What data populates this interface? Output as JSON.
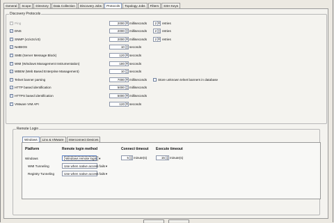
{
  "tabs": [
    {
      "label": "General",
      "active": false
    },
    {
      "label": "Scope",
      "active": false
    },
    {
      "label": "Directory",
      "active": false
    },
    {
      "label": "Data Collection",
      "active": false
    },
    {
      "label": "Discovery Jobs",
      "active": false
    },
    {
      "label": "Protocols",
      "active": true
    },
    {
      "label": "Topology Jobs",
      "active": false
    },
    {
      "label": "Filters",
      "active": false
    },
    {
      "label": "SSH Keys",
      "active": false
    }
  ],
  "discovery": {
    "title": "Discovery Protocols",
    "rows": [
      {
        "label": "Ping",
        "checked": true,
        "disabled": true,
        "value": "2000",
        "unit": "milliseconds",
        "retries": "2",
        "retries_label": "retries"
      },
      {
        "label": "DNS",
        "checked": true,
        "disabled": false,
        "value": "2000",
        "unit": "milliseconds",
        "retries": "2",
        "retries_label": "retries"
      },
      {
        "label": "SNMP (v1/v2c/v3)",
        "checked": true,
        "disabled": false,
        "value": "2000",
        "unit": "milliseconds",
        "retries": "2",
        "retries_label": "retries"
      },
      {
        "label": "NetBIOS",
        "checked": true,
        "disabled": false,
        "value": "10",
        "unit": "seconds"
      },
      {
        "label": "SMB (Server Message Block)",
        "checked": true,
        "disabled": false,
        "value": "120",
        "unit": "seconds"
      },
      {
        "label": "WMI (Windows Management Instrumentation)",
        "checked": true,
        "disabled": false,
        "value": "180",
        "unit": "seconds"
      },
      {
        "label": "WBEM (Web Based Enterprise Management)",
        "checked": true,
        "disabled": false,
        "value": "10",
        "unit": "seconds"
      },
      {
        "label": "Telnet banner parsing",
        "checked": true,
        "disabled": false,
        "value": "7000",
        "unit": "milliseconds",
        "extra_label": "Store unknown telnet banners in database",
        "extra_checked": false
      },
      {
        "label": "HTTP based identification",
        "checked": true,
        "disabled": false,
        "value": "5000",
        "unit": "milliseconds"
      },
      {
        "label": "HTTPS based identification",
        "checked": true,
        "disabled": false,
        "value": "5000",
        "unit": "milliseconds"
      },
      {
        "label": "VMware VIM API",
        "checked": true,
        "disabled": false,
        "value": "120",
        "unit": "seconds"
      }
    ]
  },
  "remote": {
    "title": "Remote Login",
    "subtabs": [
      {
        "label": "Windows",
        "active": true
      },
      {
        "label": "Linx & VMware",
        "active": false
      },
      {
        "label": "Interconnect Devices",
        "active": false
      }
    ],
    "headers": {
      "platform": "Platform",
      "method": "Remote login method",
      "connect": "Connect timeout",
      "execute": "Execute timeout"
    },
    "windows": {
      "platform": "Windows",
      "method": "Windows remote login",
      "connect_value": "5",
      "connect_unit": "minute(s)",
      "execute_value": "15",
      "execute_unit": "minute(s)"
    },
    "wmi": {
      "platform": "WMI Tunneling",
      "method": "Use when native access fails"
    },
    "registry": {
      "platform": "Registry Tunneling",
      "method": "Use when native access fails"
    }
  },
  "icons": {
    "check": "✓",
    "dropdown": "▼",
    "spin_up": "▲",
    "spin_down": "▼"
  }
}
